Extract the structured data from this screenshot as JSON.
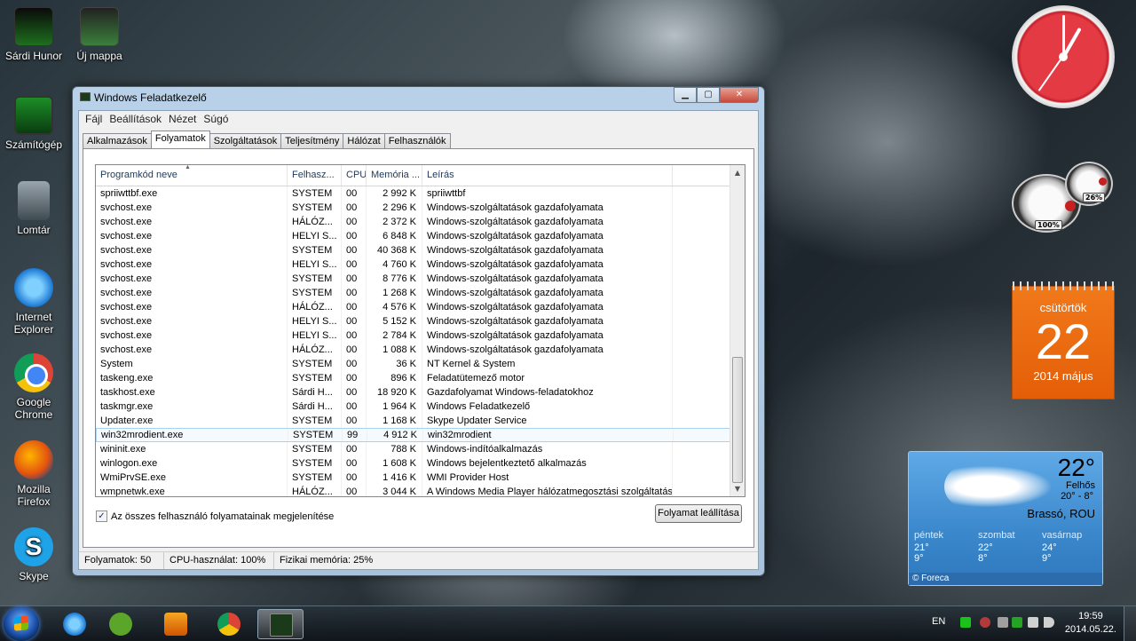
{
  "desktop_icons": [
    {
      "label": "Sárdi Hunor",
      "icon": "user-folder-icon"
    },
    {
      "label": "Új mappa",
      "icon": "folder-icon"
    },
    {
      "label": "Számítógép",
      "icon": "computer-icon"
    },
    {
      "label": "Lomtár",
      "icon": "recycle-bin-icon"
    },
    {
      "label": "Internet Explorer",
      "icon": "internet-explorer-icon"
    },
    {
      "label": "Google Chrome",
      "icon": "chrome-icon"
    },
    {
      "label": "Mozilla Firefox",
      "icon": "firefox-icon"
    },
    {
      "label": "Skype",
      "icon": "skype-icon"
    }
  ],
  "gadgets": {
    "cpu_meter": {
      "cpu": "100%",
      "memory": "26%"
    },
    "calendar": {
      "weekday": "csütörtök",
      "day": "22",
      "month_year": "2014 május"
    },
    "weather": {
      "temp": "22°",
      "condition": "Felhős",
      "range": "20°  -  8°",
      "city": "Brassó, ROU",
      "forecast": [
        {
          "day": "péntek",
          "high": "21°",
          "low": "9°"
        },
        {
          "day": "szombat",
          "high": "22°",
          "low": "8°"
        },
        {
          "day": "vasárnap",
          "high": "24°",
          "low": "9°"
        }
      ],
      "provider": "Foreca"
    }
  },
  "window": {
    "title": "Windows Feladatkezelő",
    "menu": [
      "Fájl",
      "Beállítások",
      "Nézet",
      "Súgó"
    ],
    "tabs": [
      "Alkalmazások",
      "Folyamatok",
      "Szolgáltatások",
      "Teljesítmény",
      "Hálózat",
      "Felhasználók"
    ],
    "active_tab": "Folyamatok",
    "columns": [
      "Programkód neve",
      "Felhasz...",
      "CPU",
      "Memória ...",
      "Leírás"
    ],
    "rows": [
      {
        "name": "spriiwttbf.exe",
        "user": "SYSTEM",
        "cpu": "00",
        "mem": "2 992 K",
        "desc": "spriiwttbf"
      },
      {
        "name": "svchost.exe",
        "user": "SYSTEM",
        "cpu": "00",
        "mem": "2 296 K",
        "desc": "Windows-szolgáltatások gazdafolyamata"
      },
      {
        "name": "svchost.exe",
        "user": "HÁLÓZ...",
        "cpu": "00",
        "mem": "2 372 K",
        "desc": "Windows-szolgáltatások gazdafolyamata"
      },
      {
        "name": "svchost.exe",
        "user": "HELYI S...",
        "cpu": "00",
        "mem": "6 848 K",
        "desc": "Windows-szolgáltatások gazdafolyamata"
      },
      {
        "name": "svchost.exe",
        "user": "SYSTEM",
        "cpu": "00",
        "mem": "40 368 K",
        "desc": "Windows-szolgáltatások gazdafolyamata"
      },
      {
        "name": "svchost.exe",
        "user": "HELYI S...",
        "cpu": "00",
        "mem": "4 760 K",
        "desc": "Windows-szolgáltatások gazdafolyamata"
      },
      {
        "name": "svchost.exe",
        "user": "SYSTEM",
        "cpu": "00",
        "mem": "8 776 K",
        "desc": "Windows-szolgáltatások gazdafolyamata"
      },
      {
        "name": "svchost.exe",
        "user": "SYSTEM",
        "cpu": "00",
        "mem": "1 268 K",
        "desc": "Windows-szolgáltatások gazdafolyamata"
      },
      {
        "name": "svchost.exe",
        "user": "HÁLÓZ...",
        "cpu": "00",
        "mem": "4 576 K",
        "desc": "Windows-szolgáltatások gazdafolyamata"
      },
      {
        "name": "svchost.exe",
        "user": "HELYI S...",
        "cpu": "00",
        "mem": "5 152 K",
        "desc": "Windows-szolgáltatások gazdafolyamata"
      },
      {
        "name": "svchost.exe",
        "user": "HELYI S...",
        "cpu": "00",
        "mem": "2 784 K",
        "desc": "Windows-szolgáltatások gazdafolyamata"
      },
      {
        "name": "svchost.exe",
        "user": "HÁLÓZ...",
        "cpu": "00",
        "mem": "1 088 K",
        "desc": "Windows-szolgáltatások gazdafolyamata"
      },
      {
        "name": "System",
        "user": "SYSTEM",
        "cpu": "00",
        "mem": "36 K",
        "desc": "NT Kernel & System"
      },
      {
        "name": "taskeng.exe",
        "user": "SYSTEM",
        "cpu": "00",
        "mem": "896 K",
        "desc": "Feladatütemező motor"
      },
      {
        "name": "taskhost.exe",
        "user": "Sárdi H...",
        "cpu": "00",
        "mem": "18 920 K",
        "desc": "Gazdafolyamat Windows-feladatokhoz"
      },
      {
        "name": "taskmgr.exe",
        "user": "Sárdi H...",
        "cpu": "00",
        "mem": "1 964 K",
        "desc": "Windows Feladatkezelő"
      },
      {
        "name": "Updater.exe",
        "user": "SYSTEM",
        "cpu": "00",
        "mem": "1 168 K",
        "desc": "Skype Updater Service"
      },
      {
        "name": "win32mrodient.exe",
        "user": "SYSTEM",
        "cpu": "99",
        "mem": "4 912 K",
        "desc": "win32mrodient",
        "selected": true
      },
      {
        "name": "wininit.exe",
        "user": "SYSTEM",
        "cpu": "00",
        "mem": "788 K",
        "desc": "Windows-indítóalkalmazás"
      },
      {
        "name": "winlogon.exe",
        "user": "SYSTEM",
        "cpu": "00",
        "mem": "1 608 K",
        "desc": "Windows bejelentkeztető alkalmazás"
      },
      {
        "name": "WmiPrvSE.exe",
        "user": "SYSTEM",
        "cpu": "00",
        "mem": "1 416 K",
        "desc": "WMI Provider Host"
      },
      {
        "name": "wmpnetwk.exe",
        "user": "HÁLÓZ...",
        "cpu": "00",
        "mem": "3 044 K",
        "desc": "A Windows Media Player hálózatmegosztási szolgáltatása"
      }
    ],
    "show_all_label": "Az összes felhasználó folyamatainak megjelenítése",
    "show_all_checked": true,
    "end_process_label": "Folyamat leállítása",
    "status": {
      "processes": "Folyamatok: 50",
      "cpu": "CPU-használat: 100%",
      "memory": "Fizikai memória: 25%"
    }
  },
  "taskbar": {
    "language": "EN",
    "time": "19:59",
    "date": "2014.05.22."
  }
}
